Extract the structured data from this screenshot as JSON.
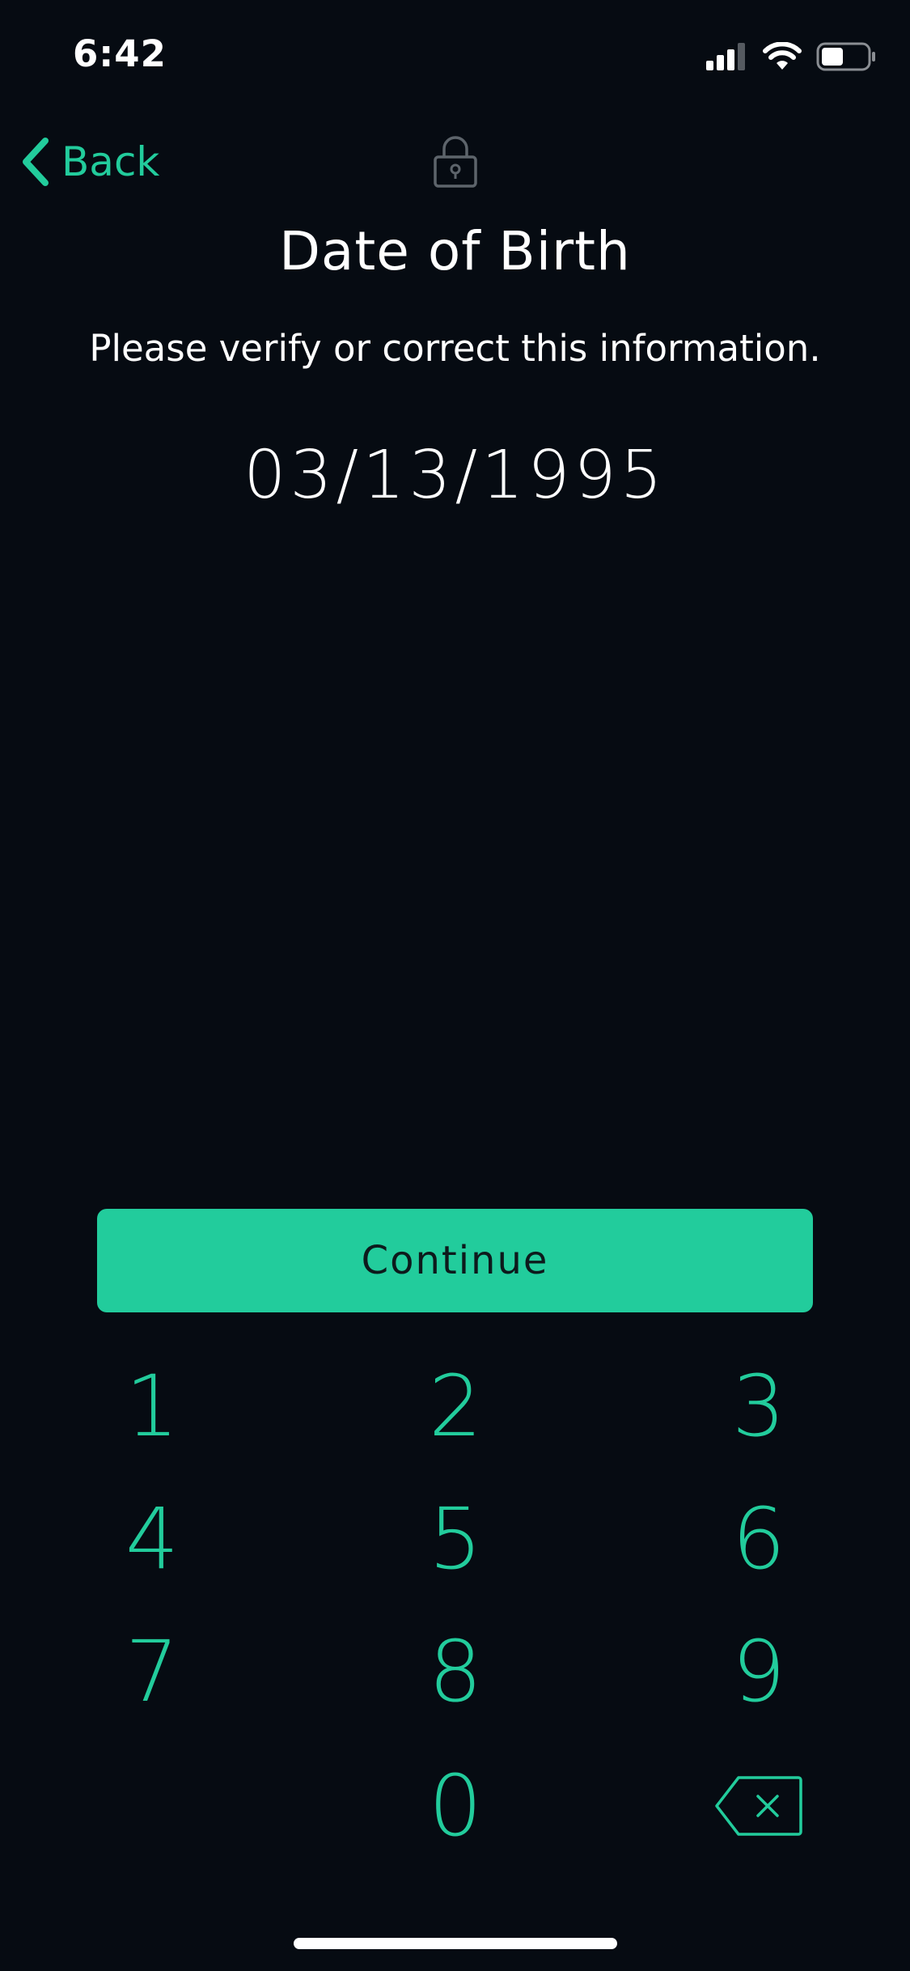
{
  "status_bar": {
    "time": "6:42"
  },
  "nav": {
    "back_label": "Back"
  },
  "page": {
    "title": "Date of Birth",
    "subtitle": "Please verify or correct this information.",
    "dob_value": "03/13/1995"
  },
  "actions": {
    "continue_label": "Continue"
  },
  "keypad": {
    "keys": [
      "1",
      "2",
      "3",
      "4",
      "5",
      "6",
      "7",
      "8",
      "9",
      "0"
    ]
  },
  "colors": {
    "background": "#060b12",
    "accent": "#22cc9c",
    "text": "#ffffff"
  }
}
